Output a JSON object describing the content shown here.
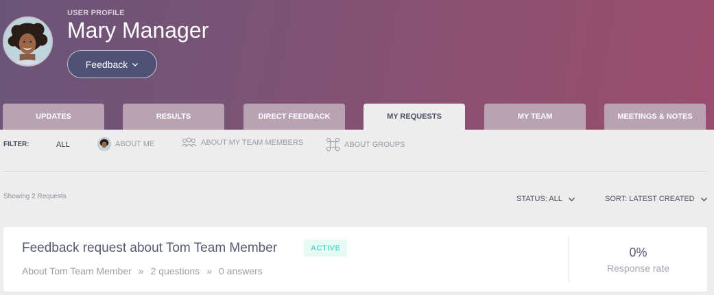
{
  "profile": {
    "section_label": "USER PROFILE",
    "name": "Mary Manager",
    "feedback_button": "Feedback"
  },
  "tabs": [
    {
      "label": "UPDATES",
      "active": false
    },
    {
      "label": "RESULTS",
      "active": false
    },
    {
      "label": "DIRECT FEEDBACK",
      "active": false
    },
    {
      "label": "MY REQUESTS",
      "active": true
    },
    {
      "label": "MY TEAM",
      "active": false
    },
    {
      "label": "MEETINGS & NOTES",
      "active": false
    }
  ],
  "filter": {
    "label": "FILTER:",
    "all": "ALL",
    "about_me": "ABOUT ME",
    "about_team": "ABOUT MY TEAM MEMBERS",
    "about_groups": "ABOUT GROUPS"
  },
  "list": {
    "showing": "Showing 2 Requests",
    "status_dropdown": "STATUS: ALL",
    "sort_dropdown": "SORT: LATEST CREATED"
  },
  "requests": [
    {
      "title": "Feedback request about Tom Team Member",
      "status": "ACTIVE",
      "about": "About Tom Team Member",
      "questions": "2 questions",
      "answers": "0 answers",
      "separator": "»",
      "response_rate": "0%",
      "response_rate_label": "Response rate"
    }
  ],
  "colors": {
    "header_gradient_start": "#6a5578",
    "header_gradient_end": "#9a4d6c",
    "tab_inactive": "#b9a3b3",
    "active_badge_text": "#5fd6c4",
    "active_badge_bg": "#e8faf6"
  }
}
